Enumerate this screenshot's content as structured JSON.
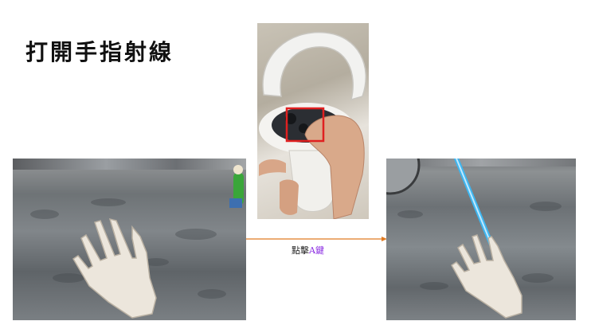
{
  "title": "打開手指射線",
  "step_label": {
    "prefix": "點擊",
    "key": "A鍵"
  },
  "colors": {
    "arrow": "#e07a20",
    "highlight_box": "#e02020",
    "laser_ray": "#3fb6f0",
    "key_text": "#8a2be2"
  },
  "images": {
    "left": "vr-hand-open-palm",
    "middle": "quest-controller-pressing-a-button",
    "right": "vr-hand-with-finger-ray"
  }
}
